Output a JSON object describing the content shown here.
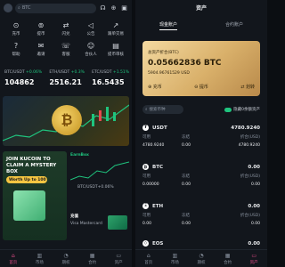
{
  "home": {
    "search_placeholder": "BTC",
    "shortcuts": [
      {
        "label": "充币",
        "icon": "deposit-icon"
      },
      {
        "label": "提币",
        "icon": "withdraw-icon"
      },
      {
        "label": "闪兑",
        "icon": "swap-icon"
      },
      {
        "label": "公告",
        "icon": "megaphone-icon"
      },
      {
        "label": "跟单交易",
        "icon": "chart-icon"
      },
      {
        "label": "帮助",
        "icon": "help-icon"
      },
      {
        "label": "邀请",
        "icon": "invite-icon"
      },
      {
        "label": "客服",
        "icon": "support-icon"
      },
      {
        "label": "合伙人",
        "icon": "partner-icon"
      },
      {
        "label": "提币审核",
        "icon": "review-icon"
      }
    ],
    "markets": [
      {
        "pair": "BTC/USDT",
        "change": "+0.06%",
        "price": "104862"
      },
      {
        "pair": "ETH/USDT",
        "change": "+0.3%",
        "price": "2516.21"
      },
      {
        "pair": "ETC/USDT",
        "change": "+1.51%",
        "price": "16.5435"
      }
    ],
    "promo": {
      "headline": "JOIN KUCOIN TO CLAIM A MYSTERY BOX",
      "button": "Worth Up to 100"
    },
    "mini_chart": {
      "tag": "EarnBox",
      "pair": "BTC/USDT+0.06%"
    },
    "card": {
      "title": "充值",
      "subtitle": "Visa Mastercard"
    }
  },
  "nav": [
    {
      "label": "首页",
      "icon": "home-icon"
    },
    {
      "label": "市场",
      "icon": "market-icon"
    },
    {
      "label": "期权",
      "icon": "options-icon"
    },
    {
      "label": "合约",
      "icon": "contract-icon"
    },
    {
      "label": "资产",
      "icon": "wallet-icon"
    }
  ],
  "assets": {
    "title": "资产",
    "tabs": [
      "现金账户",
      "合约账户"
    ],
    "balance_label": "总资产折合(BTC)",
    "balance": "0.05662836 BTC",
    "balance_fiat": "5904.96761529 USD",
    "actions": [
      "充币",
      "提币",
      "划转"
    ],
    "search_placeholder": "搜索币种",
    "hide_small": "隐藏0余额资产",
    "col_available": "可用",
    "col_frozen": "冻结",
    "col_converted": "折合(USD)",
    "list": [
      {
        "name": "USDT",
        "total": "4780.9240",
        "available": "4780.9240",
        "frozen": "0.00",
        "converted": "4780.9240"
      },
      {
        "name": "BTC",
        "total": "0.00",
        "available": "0.00000",
        "frozen": "0.00",
        "converted": "0.00"
      },
      {
        "name": "ETH",
        "total": "0.00",
        "available": "0.00",
        "frozen": "0.00",
        "converted": "0.00"
      },
      {
        "name": "EOS",
        "total": "0.00"
      }
    ]
  },
  "colors": {
    "accent_green": "#1fc47e",
    "accent_pink": "#e74c8a",
    "gold_card": "#d9b06a"
  }
}
